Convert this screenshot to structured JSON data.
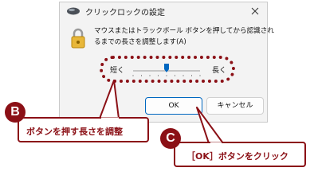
{
  "dialog": {
    "title": "クリックロックの設定",
    "message_line1": "マウスまたはトラックボール ボタンを押してから認識され",
    "message_line2": "るまでの長さを調整します(A)",
    "slider": {
      "label_short": "短く",
      "label_long": "長く",
      "level": 0.5
    },
    "ok_label": "OK",
    "cancel_label": "キャンセル"
  },
  "annotations": {
    "b": {
      "badge": "B",
      "text": "ボタンを押す長さを調整"
    },
    "c": {
      "badge": "C",
      "text": "［OK］ボタンをクリック"
    },
    "color": "#8b1016"
  }
}
